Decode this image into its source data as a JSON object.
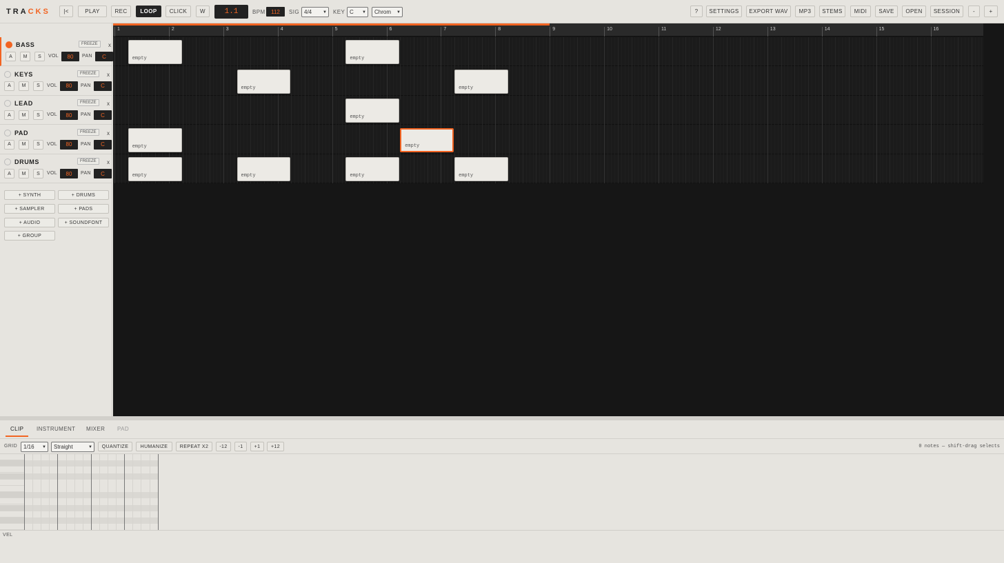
{
  "logo": {
    "part1": "TRA",
    "part2": "CKS"
  },
  "transport": {
    "rewind": "|<",
    "play": "PLAY",
    "rec": "REC",
    "loop": "LOOP",
    "click": "CLICK",
    "w": "W",
    "counter": "1.1",
    "bpm_label": "BPM",
    "bpm": "112",
    "sig_label": "SIG",
    "sig": "4/4",
    "key_label": "KEY",
    "key": "C",
    "scale": "Chrom"
  },
  "menu": {
    "help": "?",
    "settings": "SETTINGS",
    "export_wav": "EXPORT WAV",
    "mp3": "MP3",
    "stems": "STEMS",
    "midi": "MIDI",
    "save": "SAVE",
    "open": "OPEN",
    "session": "SESSION",
    "zoom_out": "-",
    "zoom_in": "+"
  },
  "tracks": [
    {
      "name": "BASS",
      "armed": true,
      "freeze": "FREEZE",
      "close": "x",
      "a": "A",
      "m": "M",
      "s": "S",
      "vol_label": "VOL",
      "vol": "80",
      "pan_label": "PAN",
      "pan": "C"
    },
    {
      "name": "KEYS",
      "armed": false,
      "freeze": "FREEZE",
      "close": "x",
      "a": "A",
      "m": "M",
      "s": "S",
      "vol_label": "VOL",
      "vol": "80",
      "pan_label": "PAN",
      "pan": "C"
    },
    {
      "name": "LEAD",
      "armed": false,
      "freeze": "FREEZE",
      "close": "x",
      "a": "A",
      "m": "M",
      "s": "S",
      "vol_label": "VOL",
      "vol": "80",
      "pan_label": "PAN",
      "pan": "C"
    },
    {
      "name": "PAD",
      "armed": false,
      "freeze": "FREEZE",
      "close": "x",
      "a": "A",
      "m": "M",
      "s": "S",
      "vol_label": "VOL",
      "vol": "80",
      "pan_label": "PAN",
      "pan": "C"
    },
    {
      "name": "DRUMS",
      "armed": false,
      "freeze": "FREEZE",
      "close": "x",
      "a": "A",
      "m": "M",
      "s": "S",
      "vol_label": "VOL",
      "vol": "80",
      "pan_label": "PAN",
      "pan": "C"
    }
  ],
  "add_buttons": {
    "synth": "+ SYNTH",
    "drums": "+ DRUMS",
    "sampler": "+ SAMPLER",
    "pads": "+ PADS",
    "audio": "+ AUDIO",
    "soundfont": "+ SOUNDFONT",
    "group": "+ GROUP"
  },
  "ruler": {
    "bars": [
      "1",
      "2",
      "3",
      "4",
      "5",
      "6",
      "7",
      "8",
      "9",
      "10",
      "11",
      "12",
      "13",
      "14",
      "15",
      "16"
    ],
    "loop_end_bar": 9
  },
  "clips": [
    {
      "track": 0,
      "bar": 1,
      "label": "empty",
      "active": false
    },
    {
      "track": 0,
      "bar": 5,
      "label": "empty",
      "active": false
    },
    {
      "track": 1,
      "bar": 3,
      "label": "empty",
      "active": false
    },
    {
      "track": 1,
      "bar": 7,
      "label": "empty",
      "active": false
    },
    {
      "track": 2,
      "bar": 5,
      "label": "empty",
      "active": false
    },
    {
      "track": 3,
      "bar": 1,
      "label": "empty",
      "active": false
    },
    {
      "track": 3,
      "bar": 6,
      "label": "empty",
      "active": true
    },
    {
      "track": 4,
      "bar": 1,
      "label": "empty",
      "active": false
    },
    {
      "track": 4,
      "bar": 3,
      "label": "empty",
      "active": false
    },
    {
      "track": 4,
      "bar": 5,
      "label": "empty",
      "active": false
    },
    {
      "track": 4,
      "bar": 7,
      "label": "empty",
      "active": false
    }
  ],
  "editor": {
    "tabs": [
      "CLIP",
      "INSTRUMENT",
      "MIXER",
      "PAD"
    ],
    "grid_label": "GRID",
    "grid": "1/16",
    "feel": "Straight",
    "quantize": "QUANTIZE",
    "humanize": "HUMANIZE",
    "repeat": "REPEAT X2",
    "t_m12": "-12",
    "t_m1": "-1",
    "t_p1": "+1",
    "t_p12": "+12",
    "notes_info": "0 notes — shift-drag selects",
    "vel_label": "VEL"
  },
  "colors": {
    "accent": "#f26422",
    "dark": "#222222",
    "arrange_bg": "#161616"
  }
}
